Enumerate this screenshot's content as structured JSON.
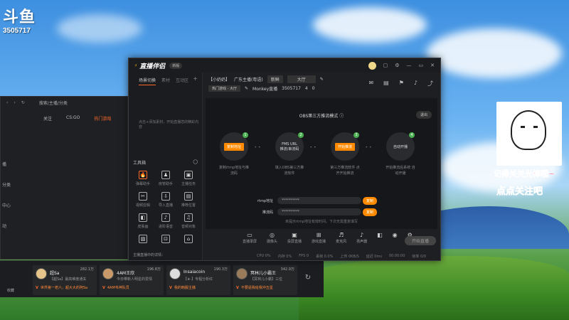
{
  "desktop": {
    "brand": "斗鱼",
    "room_id": "3505717",
    "meme_line1": "记得关关光棒哦~",
    "meme_line2": "点点关注吧"
  },
  "back_window": {
    "url": "搜索/主播/分类",
    "tabs": [
      "关注",
      "CS:GO",
      "热门游戏"
    ],
    "left_items": [
      "播",
      "分类",
      "中心",
      "动"
    ],
    "bottom": "收藏"
  },
  "strip": {
    "left_text": "收藏",
    "cards": [
      {
        "name": "超Sa",
        "heat": "282.1万",
        "desc": "【超Sa】最高难度通关",
        "foot": "世界第一老六，超大大的阿Sa"
      },
      {
        "name": "4AM王欣",
        "heat": "196.8万",
        "desc": "今日带新人明星的爱情",
        "foot": "4AM韦神队员"
      },
      {
        "name": "Insaiacoin",
        "heat": "190.3万",
        "desc": "【★·】专程分析红",
        "foot": "我的韩服主播"
      },
      {
        "name": "冥林儿小霸王",
        "heat": "342.9万",
        "desc": "【冥林儿小霸】三位",
        "foot": "不要逼我给我冲五星"
      }
    ]
  },
  "app": {
    "name": "直播伴侣",
    "version": "新版",
    "title_icons": [
      "minimize-icon",
      "skin-icon",
      "settings-icon",
      "maximize-icon",
      "close-icon"
    ],
    "left_tabs": [
      "场景切换",
      "素材",
      "互动区"
    ],
    "left_empty": "点击+添加素材，开始直播您的精彩内容",
    "tools_title": "工具箱",
    "tools": [
      {
        "label": "弹幕助手",
        "icon": "🔥",
        "hot": true
      },
      {
        "label": "房管助手",
        "icon": "♟",
        "hot": false
      },
      {
        "label": "主播任务",
        "icon": "▣",
        "hot": false
      },
      {
        "label": "视频剪辑",
        "icon": "✂",
        "hot": false
      },
      {
        "label": "导入直播",
        "icon": "⇩",
        "hot": false
      },
      {
        "label": "推荐位置",
        "icon": "▤",
        "hot": false
      },
      {
        "label": "皮肤画",
        "icon": "◧",
        "hot": false
      },
      {
        "label": "进阶语音",
        "icon": "♪",
        "hot": false
      },
      {
        "label": "音频对象",
        "icon": "♫",
        "hot": false
      },
      {
        "label": "",
        "icon": "▧",
        "hot": false
      },
      {
        "label": "",
        "icon": "⊡",
        "hot": false
      },
      {
        "label": "",
        "icon": "⌂",
        "hot": false
      }
    ],
    "left_footer": "主播直播中的详情：",
    "room": {
      "tag": "【小奶奶】",
      "category": "广东主播(粤语)",
      "chip1": "新鲜",
      "chip2": "大厅",
      "cat_chip": "热门游戏 - 大厅",
      "streamer": "Monkey直播",
      "room_no": "3505717",
      "count1": "4",
      "count2": "0"
    },
    "obs": {
      "title": "OBS第三方推流模式",
      "exit": "退出",
      "steps": [
        {
          "num": "1",
          "button": "复制地址",
          "label": "复制rtmp地址与推流码"
        },
        {
          "num": "2",
          "top": "FMS URL",
          "bottom": "推流/串流码",
          "label": "填入OBS第三方推流软件"
        },
        {
          "num": "3",
          "button": "开始推流",
          "label": "第三方推流软件 点开开始推流"
        },
        {
          "num": "4",
          "button": "自动开播",
          "label": "开始推流后系统 自动开播"
        }
      ],
      "rtmp_label": "rtmp地址",
      "rtmp_value": "**********",
      "code_label": "推流码",
      "code_value": "**********",
      "copy": "复制",
      "tip": "未提示rtmp地址有效时间，下次无需重复填写"
    },
    "bottom_tools": [
      {
        "icon": "▭",
        "label": "直播录屏"
      },
      {
        "icon": "◎",
        "label": "摄像头"
      },
      {
        "icon": "▣",
        "label": "投屏直播"
      },
      {
        "icon": "⊞",
        "label": "游戏直播"
      },
      {
        "icon": "♬",
        "label": "麦克风"
      },
      {
        "icon": "♪",
        "label": "扬声器"
      },
      {
        "icon": "◧",
        "label": ""
      },
      {
        "icon": "◉",
        "label": ""
      },
      {
        "icon": "⚙",
        "label": ""
      }
    ],
    "live_button": "开始直播",
    "status": [
      "CPU 0%",
      "内存 0%",
      "FPS 0",
      "丢帧 0.0%",
      "上传 0KB/S",
      "延迟 0ms",
      "00:00:00",
      "帧率 0/0"
    ]
  },
  "colors": {
    "accent": "#ff8a00",
    "hot": "#ff6a2b",
    "green": "#4caf50"
  }
}
